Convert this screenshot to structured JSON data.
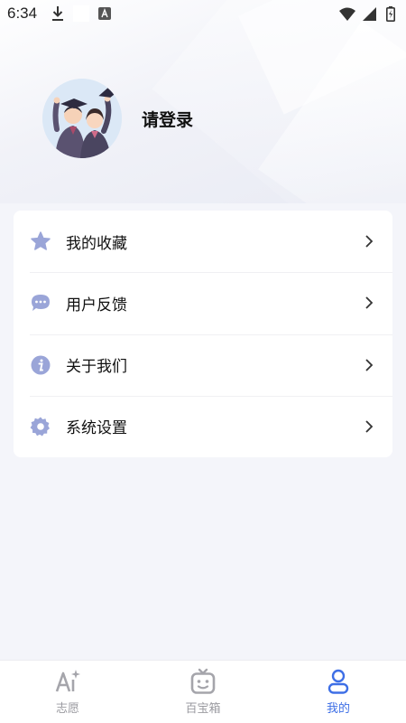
{
  "status_bar": {
    "time": "6:34",
    "left_icons": [
      "download-icon",
      "blank-notification-icon",
      "a-notification-icon"
    ],
    "right_icons": [
      "wifi-icon",
      "signal-icon",
      "battery-icon"
    ]
  },
  "profile": {
    "avatar_icon": "graduates-avatar",
    "login_text": "请登录"
  },
  "menu": {
    "items": [
      {
        "label": "我的收藏",
        "icon": "star-icon"
      },
      {
        "label": "用户反馈",
        "icon": "chat-bubble-icon"
      },
      {
        "label": "关于我们",
        "icon": "info-icon"
      },
      {
        "label": "系统设置",
        "icon": "gear-icon"
      }
    ]
  },
  "bottom_nav": {
    "items": [
      {
        "label": "志愿",
        "icon": "ai-sparkle-icon",
        "active": false
      },
      {
        "label": "百宝箱",
        "icon": "robot-box-icon",
        "active": false
      },
      {
        "label": "我的",
        "icon": "user-icon",
        "active": true
      }
    ]
  },
  "colors": {
    "accent": "#3e6fe6",
    "menu_icon": "#9aa5d8",
    "inactive": "#9a9aa0",
    "page_bg": "#f4f5fa"
  }
}
